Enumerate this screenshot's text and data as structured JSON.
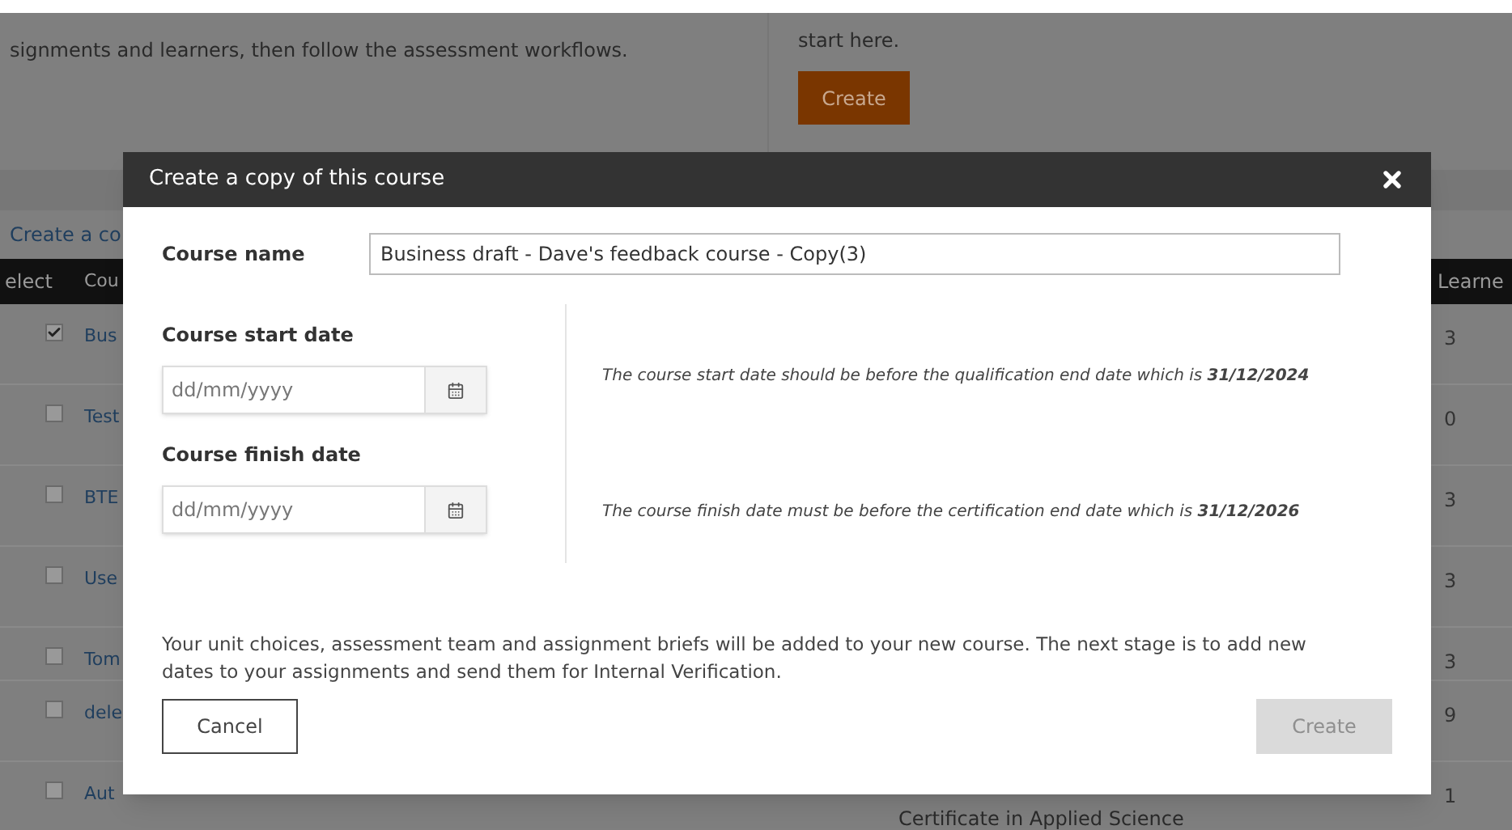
{
  "page": {
    "intro_text": "signments and learners, then follow the assessment workflows.",
    "create_panel": {
      "text": "start here.",
      "button": "Create"
    },
    "link": "Create a co",
    "table": {
      "columns": [
        "elect",
        "Cou",
        "Learne"
      ],
      "rows": [
        {
          "checked": true,
          "course": "Bus",
          "learners": "3"
        },
        {
          "checked": false,
          "course": "Test",
          "learners": "0"
        },
        {
          "checked": false,
          "course": "BTE",
          "learners": "3"
        },
        {
          "checked": false,
          "course": "Use",
          "learners": "3"
        },
        {
          "checked": false,
          "course": "Tom",
          "learners": "3"
        },
        {
          "checked": false,
          "course": "dele",
          "learners": "9"
        },
        {
          "checked": false,
          "course": "Aut",
          "learners": "1",
          "qualification": "Certificate in Applied Science"
        }
      ]
    }
  },
  "modal": {
    "title": "Create a copy of this course",
    "course_name": {
      "label": "Course name",
      "value": "Business draft - Dave's feedback course - Copy(3)"
    },
    "dates": [
      {
        "label": "Course start date",
        "placeholder": "dd/mm/yyyy",
        "note": "The course start date should be before the qualification end date which is **31/12/2024**"
      },
      {
        "label": "Course finish date",
        "placeholder": "dd/mm/yyyy",
        "note": "The course finish date must be before the certification end date which is **31/12/2026**"
      }
    ],
    "info": "Your unit choices, assessment team and assignment briefs will be added to your new course. The next stage is to add new dates to your assignments and send them for Internal Verification.",
    "cancel": "Cancel",
    "create": {
      "label": "Create",
      "disabled": true
    }
  }
}
